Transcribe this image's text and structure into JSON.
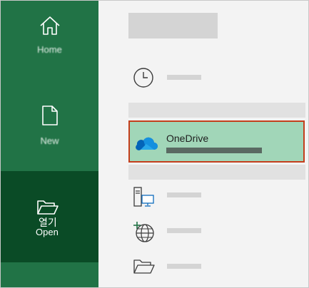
{
  "nav": {
    "home_label": "Home",
    "new_label": "New",
    "open_label_ko": "열기",
    "open_label_en": "Open"
  },
  "locations": {
    "recent_icon": "clock-icon",
    "onedrive": {
      "name": "OneDrive",
      "icon": "onedrive-cloud-icon"
    },
    "this_pc_icon": "computer-icon",
    "add_place_icon": "globe-add-icon",
    "browse_icon": "folder-icon"
  },
  "colors": {
    "nav_background": "#217346",
    "nav_selected": "#0a4b26",
    "onedrive_highlight": "#a1d6b8",
    "focus_border": "#c43e1c"
  }
}
